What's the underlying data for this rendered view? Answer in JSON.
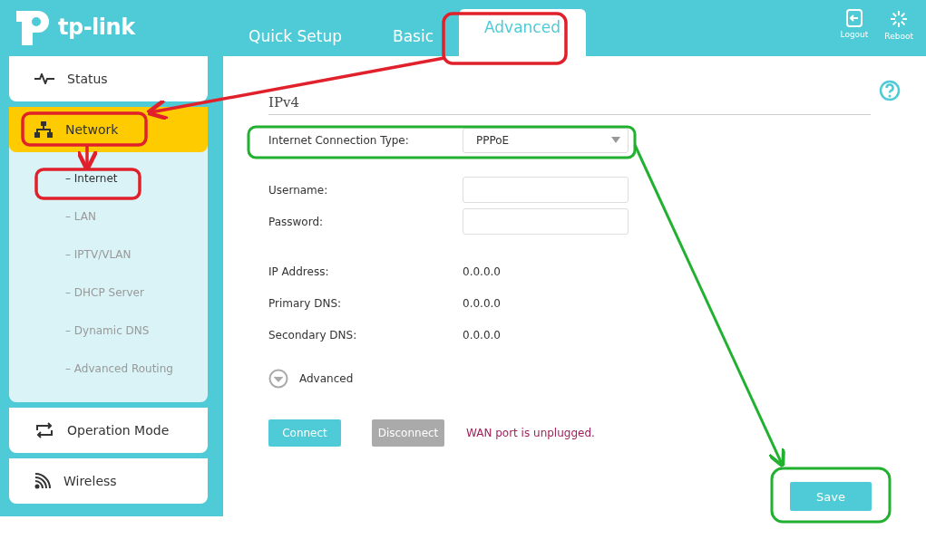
{
  "header": {
    "logo": "tp-link",
    "tabs": [
      {
        "label": "Quick Setup",
        "selected": false
      },
      {
        "label": "Basic",
        "selected": false
      },
      {
        "label": "Advanced",
        "selected": true
      }
    ],
    "actions": [
      {
        "label": "Logout"
      },
      {
        "label": "Reboot"
      }
    ]
  },
  "sidebar": {
    "items": [
      {
        "label": "Status",
        "selected": false
      },
      {
        "label": "Network",
        "selected": true,
        "children": [
          {
            "label": "– Internet",
            "selected": true
          },
          {
            "label": "– LAN",
            "selected": false
          },
          {
            "label": "– IPTV/VLAN",
            "selected": false
          },
          {
            "label": "– DHCP Server",
            "selected": false
          },
          {
            "label": "– Dynamic DNS",
            "selected": false
          },
          {
            "label": "– Advanced Routing",
            "selected": false
          }
        ]
      },
      {
        "label": "Operation Mode",
        "selected": false
      },
      {
        "label": "Wireless",
        "selected": false
      }
    ]
  },
  "main": {
    "section_title": "IPv4",
    "connection_type": {
      "label": "Internet Connection Type:",
      "value": "PPPoE"
    },
    "fields": [
      {
        "label": "Username:"
      },
      {
        "label": "Password:"
      }
    ],
    "info": [
      {
        "label": "IP Address:",
        "value": "0.0.0.0"
      },
      {
        "label": "Primary DNS:",
        "value": "0.0.0.0"
      },
      {
        "label": "Secondary DNS:",
        "value": "0.0.0.0"
      }
    ],
    "advanced_toggle": {
      "label": "Advanced",
      "expanded": false
    },
    "buttons": [
      {
        "label": "Connect",
        "disabled": false
      },
      {
        "label": "Disconnect",
        "disabled": true
      }
    ],
    "status_message": "WAN port is unplugged.",
    "save_button": "Save"
  }
}
